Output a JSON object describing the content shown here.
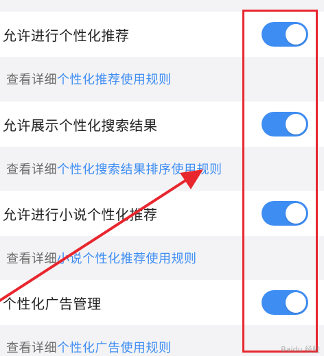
{
  "settings": [
    {
      "label": "允许进行个性化推荐",
      "toggle_on": true,
      "desc_prefix": "查看详细",
      "desc_link": "个性化推荐使用规则"
    },
    {
      "label": "允许展示个性化搜索结果",
      "toggle_on": true,
      "desc_prefix": "查看详细",
      "desc_link": "个性化搜索结果排序使用规则"
    },
    {
      "label": "允许进行小说个性化推荐",
      "toggle_on": true,
      "desc_prefix": "查看详细",
      "desc_link": "小说个性化推荐使用规则"
    },
    {
      "label": "个性化广告管理",
      "toggle_on": true,
      "desc_prefix": "查看详细",
      "desc_link": "个性化广告使用规则"
    }
  ],
  "colors": {
    "accent": "#3e8df3",
    "annotation": "#e8262e",
    "row_bg": "#ffffff",
    "desc_bg": "#f3f3f5"
  }
}
